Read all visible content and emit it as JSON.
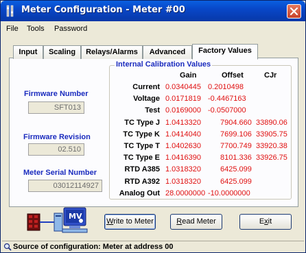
{
  "window": {
    "title": "Meter Configuration - Meter #00"
  },
  "menu": [
    "File",
    "Tools",
    "Password"
  ],
  "tabs": [
    "Input",
    "Scaling",
    "Relays/Alarms",
    "Advanced",
    "Factory Values"
  ],
  "active_tab": "Factory Values",
  "side": {
    "firmware_number_label": "Firmware Number",
    "firmware_number_value": "SFT013",
    "firmware_revision_label": "Firmware Revision",
    "firmware_revision_value": "02.510",
    "serial_label": "Meter Serial Number",
    "serial_value": "03012114927"
  },
  "calibration": {
    "title": "Internal Calibration Values",
    "headers": [
      "Gain",
      "Offset",
      "CJr"
    ],
    "rows": [
      {
        "label": "Current",
        "gain": "0.0340445",
        "offset": "0.2010498",
        "cjr": ""
      },
      {
        "label": "Voltage",
        "gain": "0.0171819",
        "offset": "-0.4467163",
        "cjr": ""
      },
      {
        "label": "Test",
        "gain": "0.0169000",
        "offset": "-0.0507000",
        "cjr": ""
      },
      {
        "label": "TC Type J",
        "gain": "1.0413320",
        "offset": "7904.660",
        "cjr": "33890.06"
      },
      {
        "label": "TC Type K",
        "gain": "1.0414040",
        "offset": "7699.106",
        "cjr": "33905.75"
      },
      {
        "label": "TC Type T",
        "gain": "1.0402630",
        "offset": "7700.749",
        "cjr": "33920.38"
      },
      {
        "label": "TC Type E",
        "gain": "1.0416390",
        "offset": "8101.336",
        "cjr": "33926.75"
      },
      {
        "label": "RTD A385",
        "gain": "1.0318320",
        "offset": "6425.099",
        "cjr": ""
      },
      {
        "label": "RTD A392",
        "gain": "1.0318320",
        "offset": "6425.099",
        "cjr": ""
      },
      {
        "label": "Analog Out",
        "gain": "28.0000000",
        "offset": "-10.0000000",
        "cjr": ""
      }
    ]
  },
  "buttons": {
    "write_pre": "",
    "write_u": "W",
    "write_post": "rite to Meter",
    "read_pre": "",
    "read_u": "R",
    "read_post": "ead Meter",
    "exit_pre": "E",
    "exit_u": "x",
    "exit_post": "it"
  },
  "status": {
    "text": "Source of configuration: Meter at address 00"
  },
  "icons": {
    "app": "meter-config-icon",
    "meter": "panel-meter-icon",
    "computer": "computer-mv-icon",
    "status": "magnifier-icon"
  },
  "colors": {
    "label_blue": "#1a2bbe",
    "value_red": "#e01010",
    "titlebar": "#0847c8"
  }
}
